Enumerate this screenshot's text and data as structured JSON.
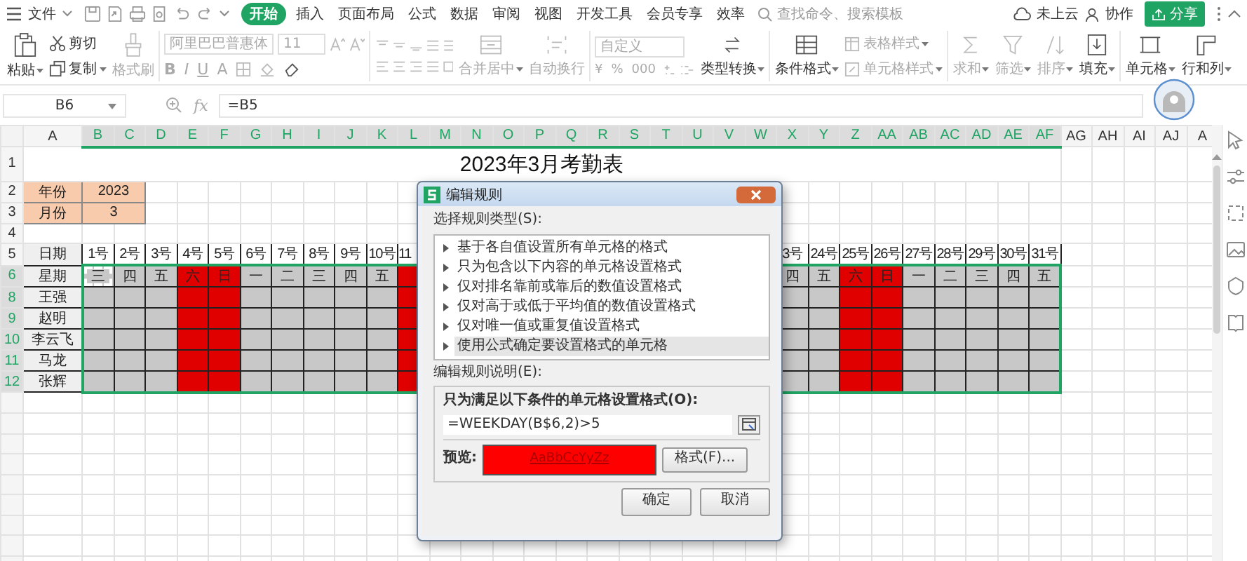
{
  "menu": {
    "file": "文件",
    "tabs": [
      {
        "label": "开始",
        "selected": true
      },
      {
        "label": "插入",
        "selected": false
      },
      {
        "label": "页面布局",
        "selected": false
      },
      {
        "label": "公式",
        "selected": false
      },
      {
        "label": "数据",
        "selected": false
      },
      {
        "label": "审阅",
        "selected": false
      },
      {
        "label": "视图",
        "selected": false
      },
      {
        "label": "开发工具",
        "selected": false
      },
      {
        "label": "会员专享",
        "selected": false
      },
      {
        "label": "效率",
        "selected": false
      }
    ],
    "search": {
      "placeholder": "查找命令、搜索模板"
    },
    "cloud": "未上云",
    "collab": "协作",
    "share": "分享"
  },
  "ribbon": {
    "paste": {
      "label": "粘贴",
      "disabled": false
    },
    "cut": {
      "label": "剪切",
      "disabled": false
    },
    "copy": {
      "label": "复制",
      "disabled": false
    },
    "painter": {
      "label": "格式刷",
      "disabled": true
    },
    "font": {
      "value": "阿里巴巴普惠体",
      "disabled": true
    },
    "size": {
      "value": "11",
      "disabled": true
    },
    "font_glyphs": [
      "B",
      "I",
      "U",
      "A"
    ],
    "merge": {
      "label": "合并居中",
      "disabled": true
    },
    "wrap": {
      "label": "自动换行",
      "disabled": true
    },
    "number_format": {
      "value": "自定义",
      "disabled": true
    },
    "number_glyphs": [
      "¥",
      "%",
      "000"
    ],
    "convert": {
      "label": "类型转换",
      "disabled": false
    },
    "cond_format": {
      "label": "条件格式",
      "disabled": false
    },
    "table_style": {
      "label": "表格样式",
      "disabled": true
    },
    "cell_style": {
      "label": "单元格样式",
      "disabled": true
    },
    "sum": {
      "label": "求和",
      "disabled": true
    },
    "filter": {
      "label": "筛选",
      "disabled": true
    },
    "sort": {
      "label": "排序",
      "disabled": true
    },
    "fill": {
      "label": "填充",
      "disabled": false
    },
    "cell": {
      "label": "单元格",
      "disabled": false
    },
    "rowcol": {
      "label": "行和列",
      "disabled": false
    }
  },
  "formula_bar": {
    "cell": "B6",
    "fx": "fx",
    "formula": "=B5"
  },
  "sheet": {
    "columns": [
      {
        "label": "A",
        "selected": false
      },
      {
        "label": "B",
        "selected": true
      },
      {
        "label": "C",
        "selected": true
      },
      {
        "label": "D",
        "selected": true
      },
      {
        "label": "E",
        "selected": true
      },
      {
        "label": "F",
        "selected": true
      },
      {
        "label": "G",
        "selected": true
      },
      {
        "label": "H",
        "selected": true
      },
      {
        "label": "I",
        "selected": true
      },
      {
        "label": "J",
        "selected": true
      },
      {
        "label": "K",
        "selected": true
      },
      {
        "label": "L",
        "selected": true
      },
      {
        "label": "M",
        "selected": true
      },
      {
        "label": "N",
        "selected": true
      },
      {
        "label": "O",
        "selected": true
      },
      {
        "label": "P",
        "selected": true
      },
      {
        "label": "Q",
        "selected": true
      },
      {
        "label": "R",
        "selected": true
      },
      {
        "label": "S",
        "selected": true
      },
      {
        "label": "T",
        "selected": true
      },
      {
        "label": "U",
        "selected": true
      },
      {
        "label": "V",
        "selected": true
      },
      {
        "label": "W",
        "selected": true
      },
      {
        "label": "X",
        "selected": true
      },
      {
        "label": "Y",
        "selected": true
      },
      {
        "label": "Z",
        "selected": true
      },
      {
        "label": "AA",
        "selected": true
      },
      {
        "label": "AB",
        "selected": true
      },
      {
        "label": "AC",
        "selected": true
      },
      {
        "label": "AD",
        "selected": true
      },
      {
        "label": "AE",
        "selected": true
      },
      {
        "label": "AF",
        "selected": true
      },
      {
        "label": "AG",
        "selected": false
      },
      {
        "label": "AH",
        "selected": false
      },
      {
        "label": "AI",
        "selected": false
      },
      {
        "label": "AJ",
        "selected": false
      },
      {
        "label": "A",
        "selected": false
      }
    ],
    "rows": [
      {
        "label": "1",
        "selected": false
      },
      {
        "label": "2",
        "selected": false
      },
      {
        "label": "3",
        "selected": false
      },
      {
        "label": "4",
        "selected": false
      },
      {
        "label": "5",
        "selected": false
      },
      {
        "label": "6",
        "selected": true
      },
      {
        "label": "8",
        "selected": true
      },
      {
        "label": "9",
        "selected": true
      },
      {
        "label": "10",
        "selected": true
      },
      {
        "label": "11",
        "selected": true
      },
      {
        "label": "12",
        "selected": true
      }
    ],
    "title": "2023年3月考勤表",
    "params": [
      {
        "label": "年份",
        "value": "2023"
      },
      {
        "label": "月份",
        "value": "3"
      }
    ],
    "date_label": "日期",
    "weekday_label": "星期",
    "days_left": [
      {
        "date": "1号",
        "weekday": "三",
        "weekend": false
      },
      {
        "date": "2号",
        "weekday": "四",
        "weekend": false
      },
      {
        "date": "3号",
        "weekday": "五",
        "weekend": false
      },
      {
        "date": "4号",
        "weekday": "六",
        "weekend": true
      },
      {
        "date": "5号",
        "weekday": "日",
        "weekend": true
      },
      {
        "date": "6号",
        "weekday": "一",
        "weekend": false
      },
      {
        "date": "7号",
        "weekday": "二",
        "weekend": false
      },
      {
        "date": "8号",
        "weekday": "三",
        "weekend": false
      },
      {
        "date": "9号",
        "weekday": "四",
        "weekend": false
      },
      {
        "date": "10号",
        "weekday": "五",
        "weekend": false
      },
      {
        "date": "11",
        "weekend": true
      }
    ],
    "days_right": [
      {
        "date": "3号",
        "weekday": "四",
        "weekend": false
      },
      {
        "date": "24号",
        "weekday": "五",
        "weekend": false
      },
      {
        "date": "25号",
        "weekday": "六",
        "weekend": true
      },
      {
        "date": "26号",
        "weekday": "日",
        "weekend": true
      },
      {
        "date": "27号",
        "weekday": "一",
        "weekend": false
      },
      {
        "date": "28号",
        "weekday": "二",
        "weekend": false
      },
      {
        "date": "29号",
        "weekday": "三",
        "weekend": false
      },
      {
        "date": "30号",
        "weekday": "四",
        "weekend": false
      },
      {
        "date": "31号",
        "weekday": "五",
        "weekend": false
      }
    ],
    "names": [
      "王强",
      "赵明",
      "李云飞",
      "马龙",
      "张辉"
    ]
  },
  "dialog": {
    "title": "编辑规则",
    "type_label": "选择规则类型(S):",
    "rule_types": [
      {
        "label": "基于各自值设置所有单元格的格式",
        "selected": false
      },
      {
        "label": "只为包含以下内容的单元格设置格式",
        "selected": false
      },
      {
        "label": "仅对排名靠前或靠后的数值设置格式",
        "selected": false
      },
      {
        "label": "仅对高于或低于平均值的数值设置格式",
        "selected": false
      },
      {
        "label": "仅对唯一值或重复值设置格式",
        "selected": false
      },
      {
        "label": "使用公式确定要设置格式的单元格",
        "selected": true
      }
    ],
    "desc_label": "编辑规则说明(E):",
    "condition_label": "只为满足以下条件的单元格设置格式(O):",
    "formula": "=WEEKDAY(B$6,2)>5",
    "preview_label": "预览:",
    "preview_text": "AaBbCcYyZz",
    "format_button": "格式(F)...",
    "ok": "确定",
    "cancel": "取消"
  }
}
